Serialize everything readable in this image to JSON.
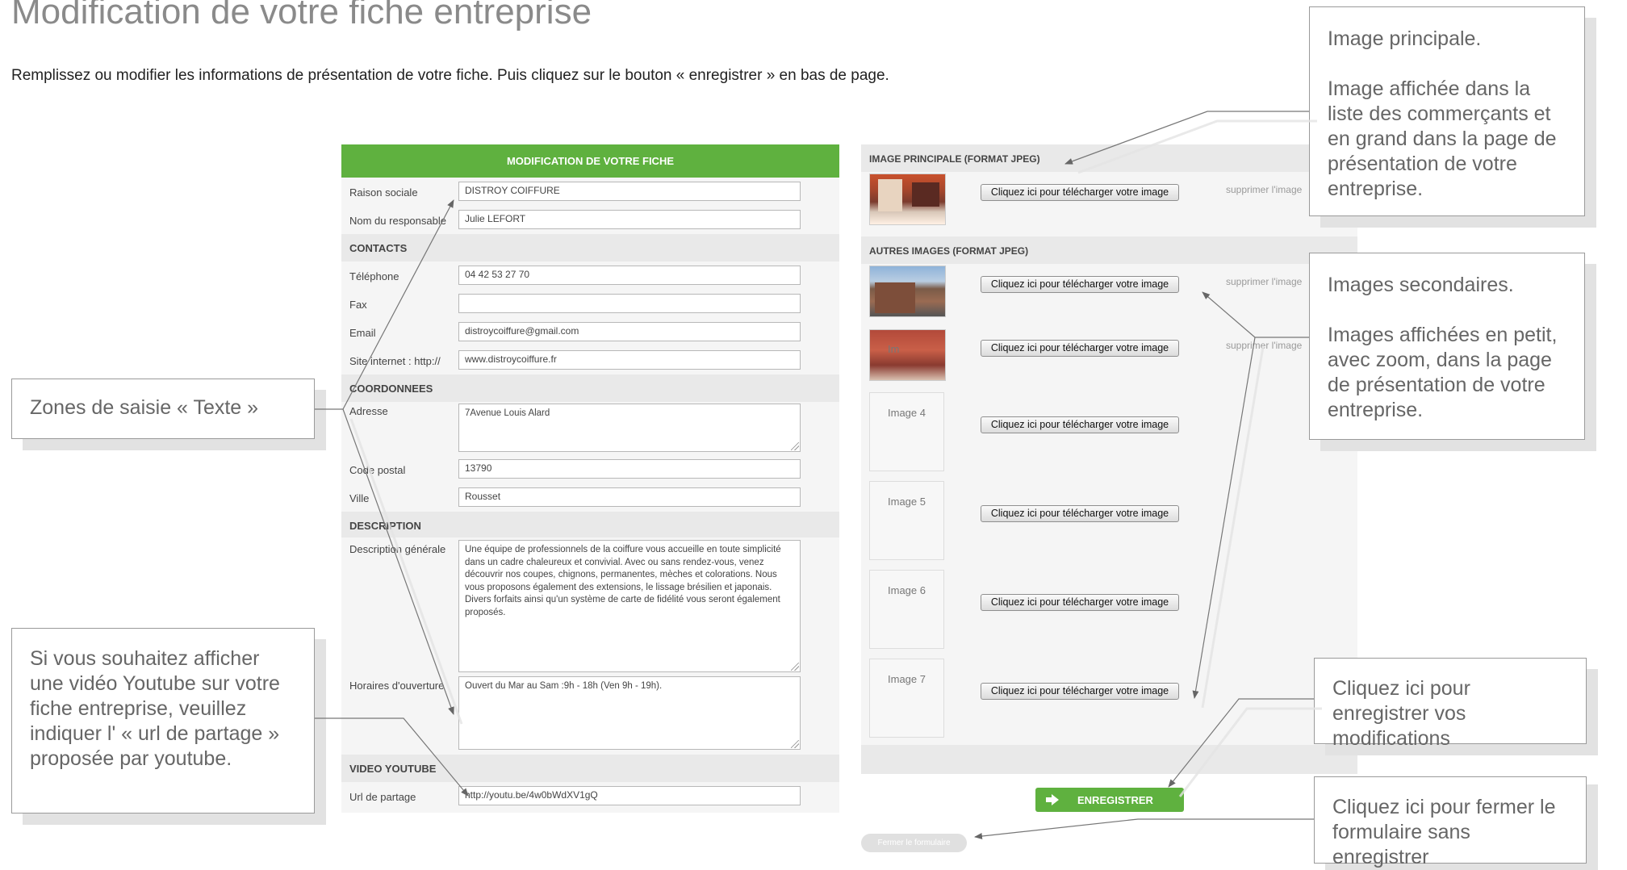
{
  "page": {
    "title": "Modification de votre fiche entreprise",
    "intro": "Remplissez ou modifier les informations de présentation de votre fiche. Puis cliquez sur le bouton « enregistrer » en bas de page."
  },
  "form": {
    "header": "MODIFICATION DE VOTRE FICHE",
    "raison_sociale": {
      "label": "Raison sociale",
      "value": "DISTROY COIFFURE"
    },
    "responsable": {
      "label": "Nom du responsable",
      "value": "Julie LEFORT"
    },
    "contacts_heading": "CONTACTS",
    "telephone": {
      "label": "Téléphone",
      "value": "04 42 53 27 70"
    },
    "fax": {
      "label": "Fax",
      "value": ""
    },
    "email": {
      "label": "Email",
      "value": "distroycoiffure@gmail.com"
    },
    "site": {
      "label": "Site internet : http://",
      "value": "www.distroycoiffure.fr"
    },
    "coordonnees_heading": "COORDONNEES",
    "adresse": {
      "label": "Adresse",
      "value": "7Avenue Louis Alard"
    },
    "code_postal": {
      "label": "Code postal",
      "value": "13790"
    },
    "ville": {
      "label": "Ville",
      "value": "Rousset"
    },
    "description_heading": "DESCRIPTION",
    "description": {
      "label": "Description générale",
      "value": "Une équipe de professionnels de la coiffure vous accueille en toute simplicité dans un cadre chaleureux et convivial. Avec ou sans rendez-vous, venez découvrir nos coupes, chignons, permanentes, mèches et colorations. Nous vous proposons également des extensions, le lissage brésilien et japonais. Divers forfaits ainsi qu'un système de carte de fidélité vous seront également proposés."
    },
    "horaires": {
      "label": "Horaires d'ouverture",
      "value": "Ouvert du Mar au Sam :9h - 18h (Ven 9h - 19h)."
    },
    "video_heading": "VIDEO YOUTUBE",
    "url_partage": {
      "label": "Url de partage",
      "value": "http://youtu.be/4w0bWdXV1gQ"
    }
  },
  "images": {
    "main_heading": "IMAGE PRINCIPALE (FORMAT JPEG)",
    "other_heading": "AUTRES IMAGES (FORMAT JPEG)",
    "upload_label": "Cliquez ici pour télécharger votre image",
    "delete_label": "supprimer l'image",
    "thumb2_overlay": "Im",
    "placeholders": [
      "Image 4",
      "Image 5",
      "Image 6",
      "Image 7"
    ]
  },
  "actions": {
    "save_label": "ENREGISTRER",
    "close_label": "Fermer le formulaire"
  },
  "callouts": {
    "main_image": {
      "title": "Image principale.",
      "body": "Image affichée dans la liste des commerçants et en grand dans la page de présentation de votre entreprise."
    },
    "secondary_images": {
      "title": "Images secondaires.",
      "body": "Images affichées en petit, avec zoom, dans la page de présentation de votre entreprise."
    },
    "text_zones": "Zones de saisie « Texte »",
    "youtube": "Si vous souhaitez afficher une vidéo Youtube sur votre fiche entreprise, veuillez indiquer l' « url de partage » proposée par youtube.",
    "save": "Cliquez ici pour enregistrer vos modifications",
    "close": "Cliquez ici pour fermer le formulaire sans enregistrer"
  },
  "colors": {
    "accent": "#5fb13f",
    "panel": "#f5f5f5",
    "section": "#e9e9e9",
    "callout_text": "#666666"
  }
}
